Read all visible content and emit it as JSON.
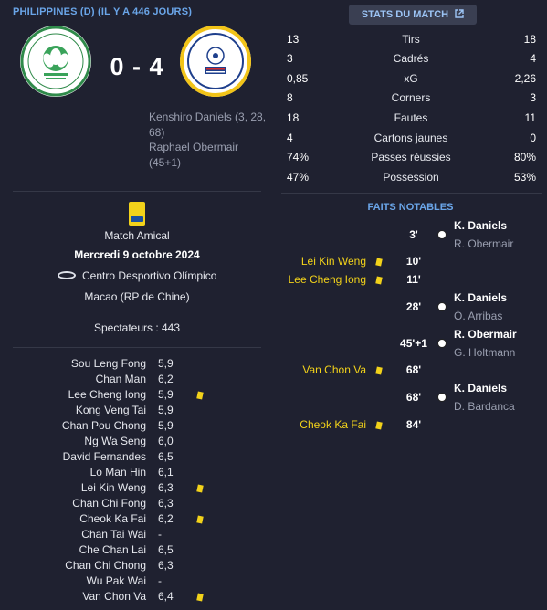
{
  "header": {
    "title": "PHILIPPINES (D) (IL Y A 446 JOURS)"
  },
  "match": {
    "score": "0 - 4",
    "scorers": [
      "Kenshiro Daniels (3, 28,",
      "68)",
      "Raphael Obermair",
      "(45+1)"
    ],
    "competition": "Match Amical",
    "date": "Mercredi 9 octobre 2024",
    "stadium": "Centro Desportivo Olímpico",
    "city": "Macao (RP de Chine)",
    "spectators": "Spectateurs : 443"
  },
  "lineup": [
    {
      "name": "Sou Leng Fong",
      "rating": "5,9",
      "card": false
    },
    {
      "name": "Chan Man",
      "rating": "6,2",
      "card": false
    },
    {
      "name": "Lee Cheng Iong",
      "rating": "5,9",
      "card": true
    },
    {
      "name": "Kong Veng Tai",
      "rating": "5,9",
      "card": false
    },
    {
      "name": "Chan Pou Chong",
      "rating": "5,9",
      "card": false
    },
    {
      "name": "Ng Wa Seng",
      "rating": "6,0",
      "card": false
    },
    {
      "name": "David Fernandes",
      "rating": "6,5",
      "card": false
    },
    {
      "name": "Lo Man Hin",
      "rating": "6,1",
      "card": false
    },
    {
      "name": "Lei Kin Weng",
      "rating": "6,3",
      "card": true
    },
    {
      "name": "Chan Chi Fong",
      "rating": "6,3",
      "card": false
    },
    {
      "name": "Cheok Ka Fai",
      "rating": "6,2",
      "card": true
    },
    {
      "name": "Chan Tai Wai",
      "rating": "-",
      "card": false
    },
    {
      "name": "Che Chan Lai",
      "rating": "6,5",
      "card": false
    },
    {
      "name": "Chan Chi Chong",
      "rating": "6,3",
      "card": false
    },
    {
      "name": "Wu Pak Wai",
      "rating": "-",
      "card": false
    },
    {
      "name": "Van Chon Va",
      "rating": "6,4",
      "card": true
    }
  ],
  "stats_button": {
    "label": "STATS DU MATCH",
    "icon": "external-link-icon"
  },
  "stats": [
    {
      "label": "Tirs",
      "home": "13",
      "away": "18"
    },
    {
      "label": "Cadrés",
      "home": "3",
      "away": "4"
    },
    {
      "label": "xG",
      "home": "0,85",
      "away": "2,26"
    },
    {
      "label": "Corners",
      "home": "8",
      "away": "3"
    },
    {
      "label": "Fautes",
      "home": "18",
      "away": "11"
    },
    {
      "label": "Cartons jaunes",
      "home": "4",
      "away": "0"
    },
    {
      "label": "Passes réussies",
      "home": "74%",
      "away": "80%"
    },
    {
      "label": "Possession",
      "home": "47%",
      "away": "53%"
    }
  ],
  "faits": {
    "title": "FAITS NOTABLES",
    "events": [
      {
        "minute": "3'",
        "type": "goal",
        "scorer": "K. Daniels",
        "assist": "R. Obermair"
      },
      {
        "minute": "10'",
        "type": "card",
        "player": "Lei Kin Weng"
      },
      {
        "minute": "11'",
        "type": "card",
        "player": "Lee Cheng Iong"
      },
      {
        "minute": "28'",
        "type": "goal",
        "scorer": "K. Daniels",
        "assist": "Ó. Arribas"
      },
      {
        "minute": "45'+1",
        "type": "goal",
        "scorer": "R. Obermair",
        "assist": "G. Holtmann"
      },
      {
        "minute": "68'",
        "type": "card",
        "player": "Van Chon Va"
      },
      {
        "minute": "68'",
        "type": "goal",
        "scorer": "K. Daniels",
        "assist": "D. Bardanca"
      },
      {
        "minute": "84'",
        "type": "card",
        "player": "Cheok Ka Fai"
      }
    ]
  },
  "colors": {
    "accent": "#6aa5e8",
    "card": "#f2d21a",
    "background": "#1f2130"
  }
}
